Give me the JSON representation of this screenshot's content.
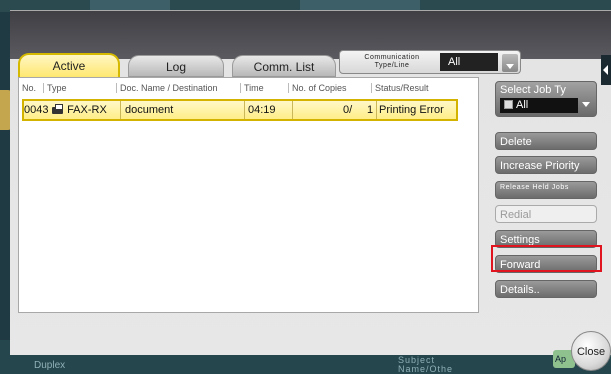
{
  "tabs": {
    "active": "Active",
    "log": "Log",
    "comm_list": "Comm. List"
  },
  "comm_type": {
    "label": "Communication Type/Line",
    "value": "All"
  },
  "table": {
    "headers": [
      "No.",
      "Type",
      "Doc. Name / Destination",
      "Time",
      "No. of Copies",
      "Status/Result"
    ],
    "rows": [
      {
        "no": "0043",
        "type": "FAX-RX",
        "doc_name": "document",
        "time": "04:19",
        "copies_done": "0/",
        "copies_total": "1",
        "status": "Printing Error"
      }
    ]
  },
  "side": {
    "select_job_label": "Select Job Ty",
    "select_job_value": "All",
    "delete": "Delete",
    "increase_priority": "Increase Priority",
    "release_held_jobs": "Release Held Jobs",
    "redial": "Redial",
    "settings": "Settings",
    "forward": "Forward",
    "details": "Details.."
  },
  "footer": {
    "duplex": "Duplex",
    "subject": "Subject Name/Othe",
    "close": "Close",
    "ap": "Ap"
  },
  "colors": {
    "tab_active": "#ffe870",
    "row_highlight": "#fff4a8",
    "highlight_border": "#e0141e"
  }
}
